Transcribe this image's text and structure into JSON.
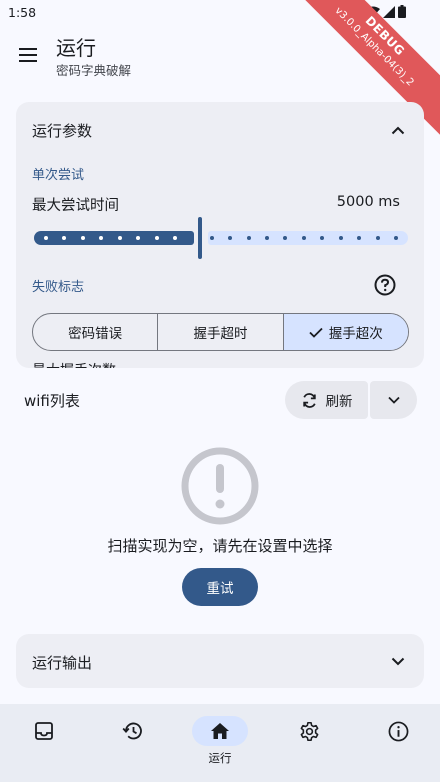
{
  "status_bar": {
    "time": "1:58"
  },
  "debug_banner": {
    "label": "DEBUG",
    "version": "v3.0.0_Alpha-04(3)_2"
  },
  "app_bar": {
    "title": "运行",
    "subtitle": "密码字典破解"
  },
  "params_card": {
    "title": "运行参数",
    "expanded": true,
    "single_attempt": {
      "section_label": "单次尝试",
      "max_time_label": "最大尝试时间",
      "max_time_value": "5000 ms",
      "slider_fraction": 0.445
    },
    "failure": {
      "section_label": "失败标志",
      "options": [
        {
          "label": "密码错误",
          "selected": false
        },
        {
          "label": "握手超时",
          "selected": false
        },
        {
          "label": "握手超次",
          "selected": true
        }
      ]
    },
    "clipped_next_label": "最大握手次数"
  },
  "wifi": {
    "title": "wifi列表",
    "refresh_label": "刷新",
    "empty_message": "扫描实现为空，请先在设置中选择",
    "retry_label": "重试"
  },
  "output_card": {
    "title": "运行输出",
    "expanded": false
  },
  "bottom_nav": [
    {
      "name": "inbox-icon",
      "label": "",
      "active": false
    },
    {
      "name": "history-icon",
      "label": "",
      "active": false
    },
    {
      "name": "home-icon",
      "label": "运行",
      "active": true
    },
    {
      "name": "settings-icon",
      "label": "",
      "active": false
    },
    {
      "name": "info-icon",
      "label": "",
      "active": false
    }
  ],
  "colors": {
    "primary": "#33598a",
    "primary_container": "#d6e3ff",
    "surface": "#f8f9ff",
    "card": "#edeef4",
    "debug_ribbon": "#e0585a"
  }
}
